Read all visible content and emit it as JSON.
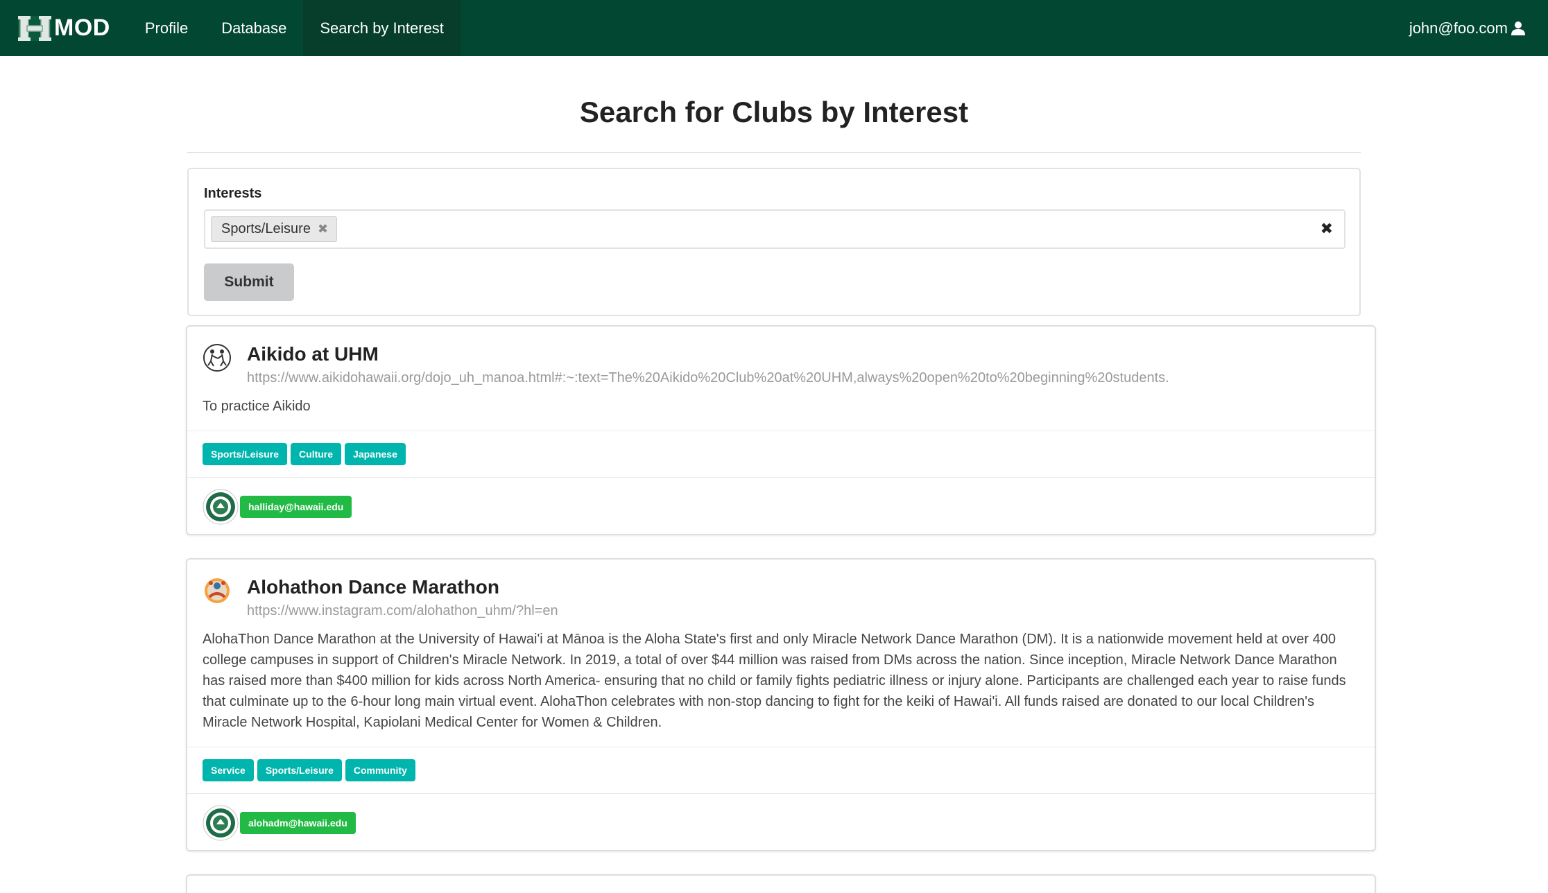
{
  "nav": {
    "brand": "MOD",
    "items": [
      {
        "label": "Profile"
      },
      {
        "label": "Database"
      },
      {
        "label": "Search by Interest"
      }
    ],
    "user": "john@foo.com"
  },
  "page": {
    "title": "Search for Clubs by Interest"
  },
  "form": {
    "interests_label": "Interests",
    "selected_interests": [
      "Sports/Leisure"
    ],
    "submit_label": "Submit"
  },
  "clubs": [
    {
      "name": "Aikido at UHM",
      "url": "https://www.aikidohawaii.org/dojo_uh_manoa.html#:~:text=The%20Aikido%20Club%20at%20UHM,always%20open%20to%20beginning%20students.",
      "description": "To practice Aikido",
      "tags": [
        "Sports/Leisure",
        "Culture",
        "Japanese"
      ],
      "owner": "halliday@hawaii.edu"
    },
    {
      "name": "Alohathon Dance Marathon",
      "url": "https://www.instagram.com/alohathon_uhm/?hl=en",
      "description": "AlohaThon Dance Marathon at the University of Hawai'i at Mānoa is the Aloha State's first and only Miracle Network Dance Marathon (DM). It is a nationwide movement held at over 400 college campuses in support of Children's Miracle Network. In 2019, a total of over $44 million was raised from DMs across the nation. Since inception, Miracle Network Dance Marathon has raised more than $400 million for kids across North America- ensuring that no child or family fights pediatric illness or injury alone. Participants are challenged each year to raise funds that culminate up to the 6-hour long main virtual event. AlohaThon celebrates with non-stop dancing to fight for the keiki of Hawai'i. All funds raised are donated to our local Children's Miracle Network Hospital, Kapiolani Medical Center for Women & Children.",
      "tags": [
        "Service",
        "Sports/Leisure",
        "Community"
      ],
      "owner": "alohadm@hawaii.edu"
    }
  ],
  "colors": {
    "navbar": "#024731",
    "tag_teal": "#00b5ad",
    "owner_green": "#21ba45"
  }
}
